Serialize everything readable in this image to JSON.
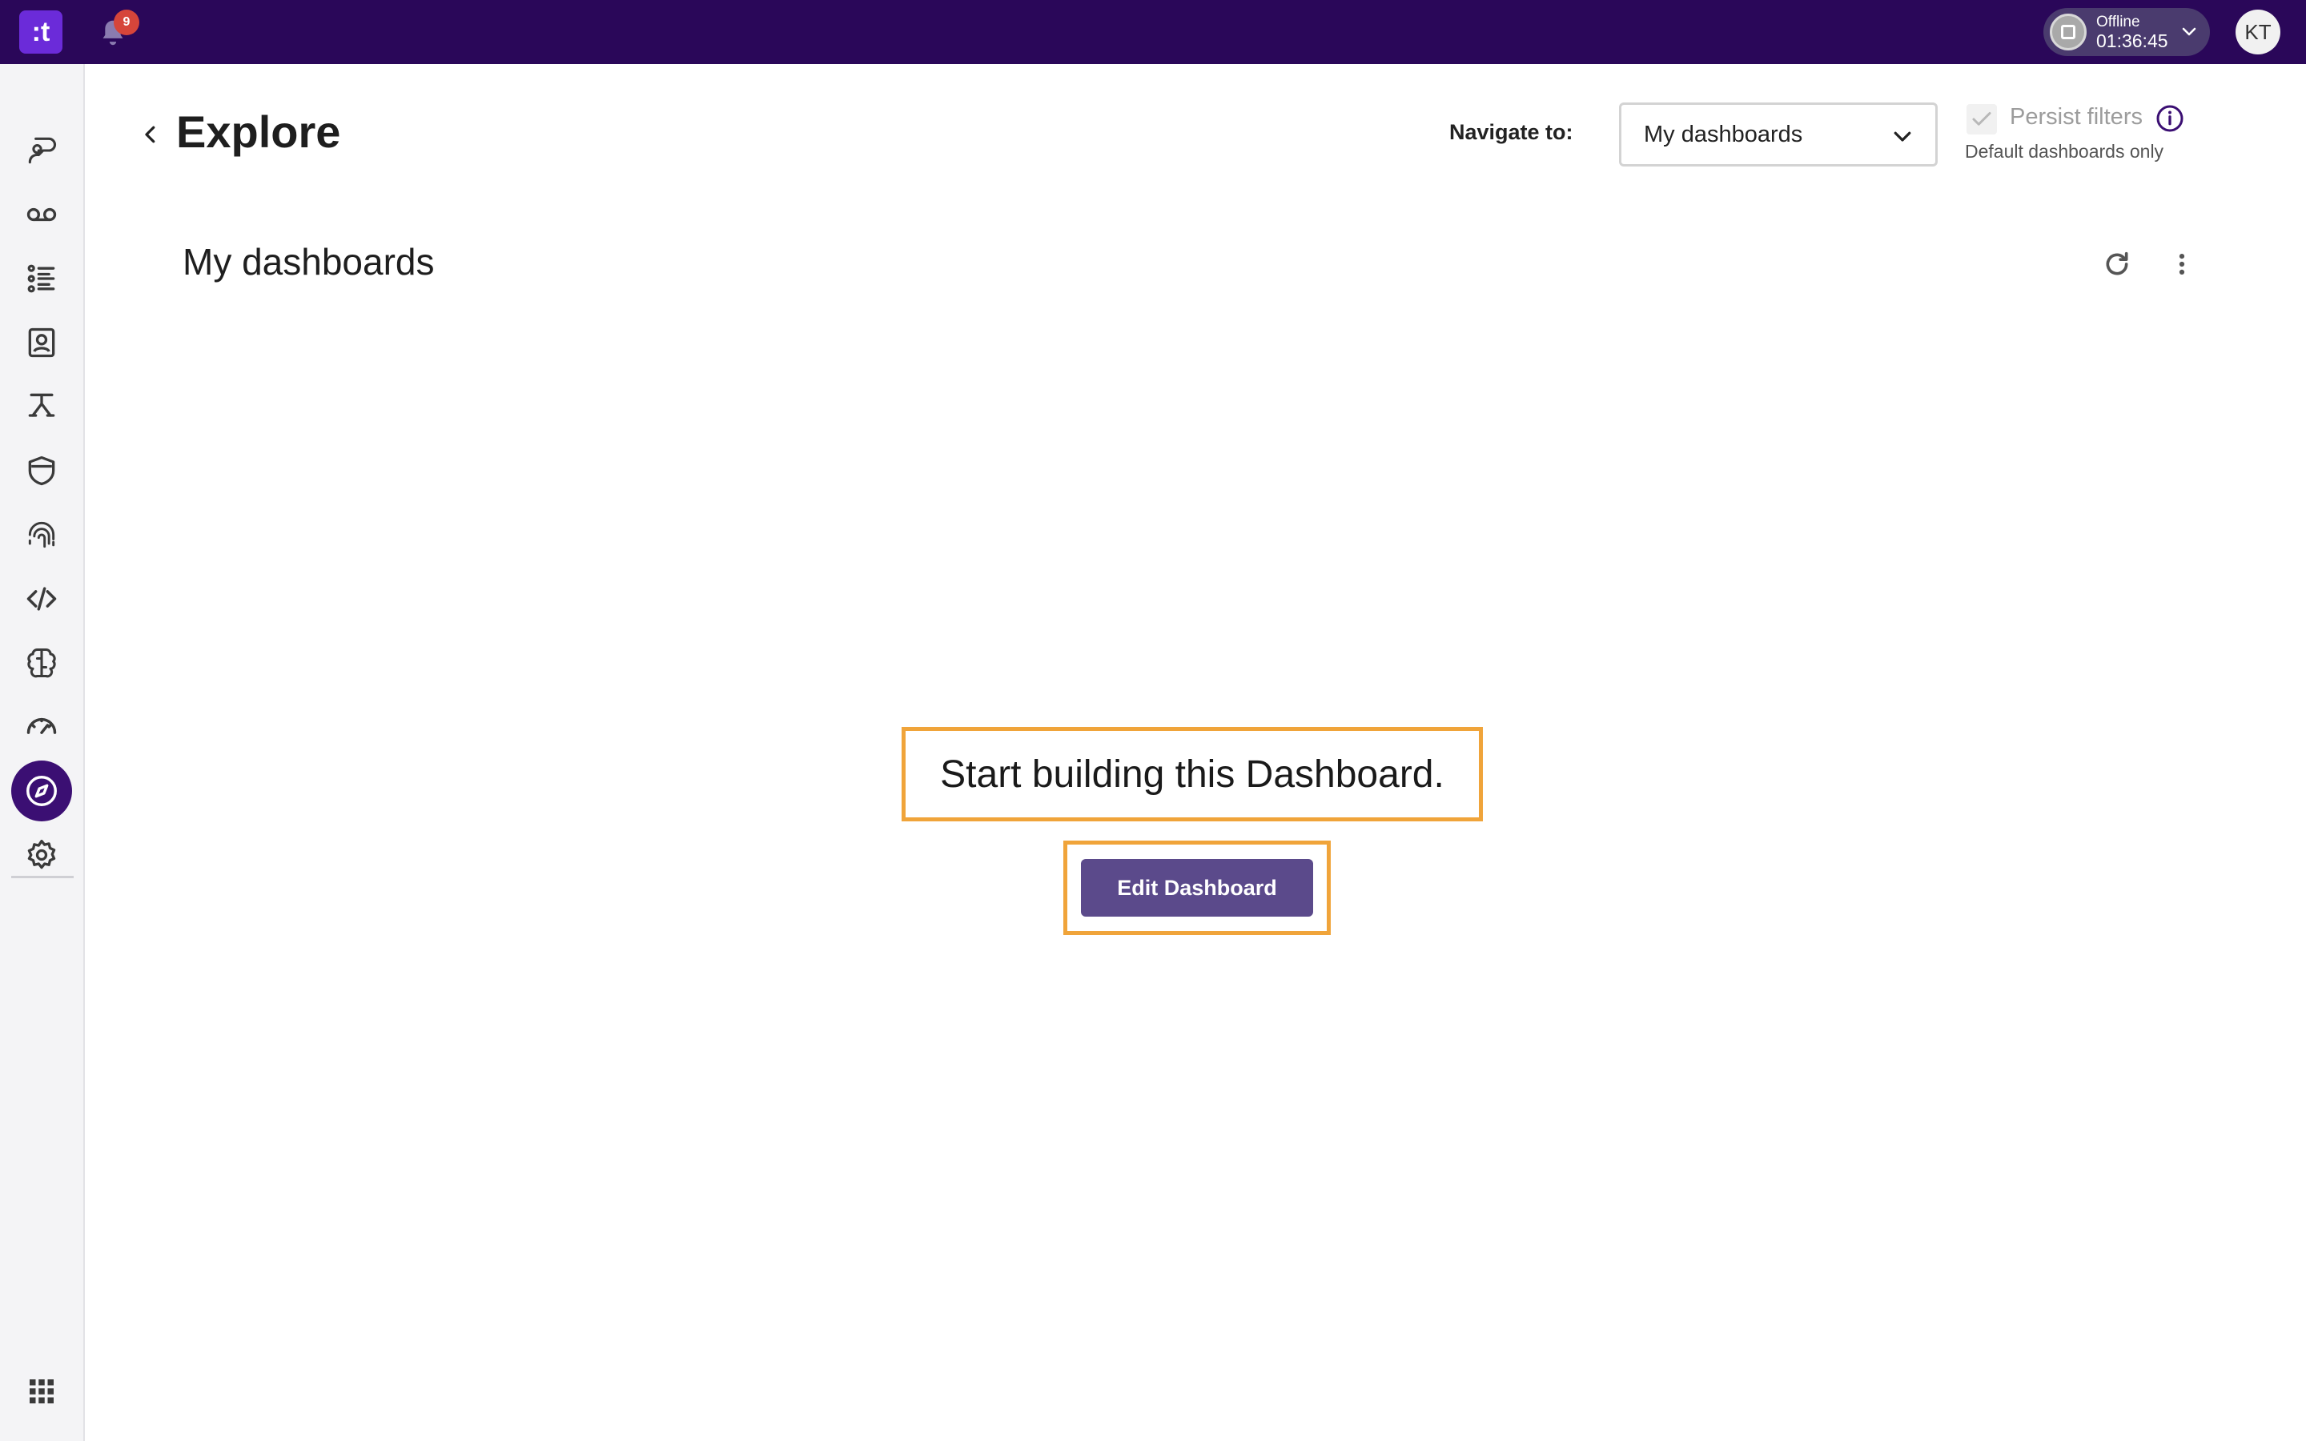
{
  "topbar": {
    "logo_text": ":t",
    "notifications_count": "9",
    "status": {
      "label": "Offline",
      "timer": "01:36:45"
    },
    "avatar_initials": "KT"
  },
  "sidebar": {
    "items": [
      {
        "icon": "conversations-icon",
        "active": false
      },
      {
        "icon": "voicemail-icon",
        "active": false
      },
      {
        "icon": "list-icon",
        "active": false
      },
      {
        "icon": "contacts-icon",
        "active": false
      },
      {
        "icon": "routing-icon",
        "active": false
      },
      {
        "icon": "shield-icon",
        "active": false
      },
      {
        "icon": "fingerprint-icon",
        "active": false
      },
      {
        "icon": "code-icon",
        "active": false
      },
      {
        "icon": "brain-icon",
        "active": false
      },
      {
        "icon": "gauge-icon",
        "active": false
      },
      {
        "icon": "compass-icon",
        "active": true
      },
      {
        "icon": "settings-icon",
        "active": false
      }
    ],
    "bottom_icon": "app-grid-icon"
  },
  "header": {
    "title": "Explore",
    "navigate_label": "Navigate to:",
    "navigate_value": "My dashboards",
    "persist_filters_label": "Persist filters",
    "persist_filters_checked": true,
    "persist_filters_note": "Default dashboards only"
  },
  "dashboard": {
    "title": "My dashboards",
    "empty_message": "Start building this Dashboard.",
    "edit_button_label": "Edit Dashboard"
  },
  "colors": {
    "topbar": "#2a0759",
    "accent": "#3b0f73",
    "button": "#5b4a8b",
    "highlight_border": "#f0a43a",
    "badge": "#d6453a"
  }
}
